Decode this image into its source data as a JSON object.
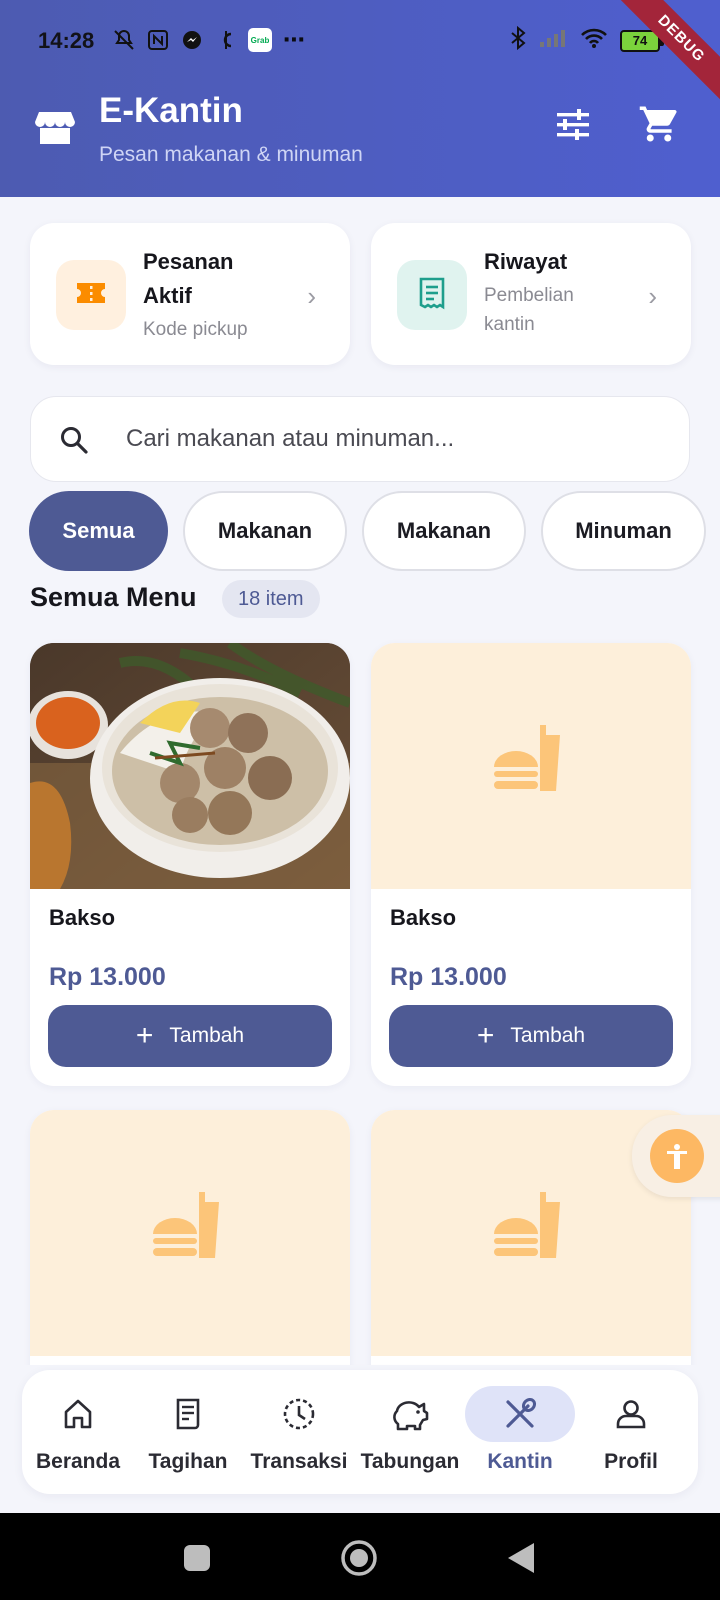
{
  "status": {
    "time": "14:28",
    "battery": "74",
    "debug_label": "DEBUG",
    "grab_label": "Grab"
  },
  "header": {
    "title": "E-Kantin",
    "subtitle": "Pesan makanan & minuman",
    "icons": [
      "store-icon",
      "filter-icon",
      "cart-icon"
    ]
  },
  "quick_cards": [
    {
      "title_line1": "Pesanan",
      "title_line2": "Aktif",
      "subtitle": "Kode pickup",
      "icon": "ticket-icon",
      "color": "#fb8c00",
      "bg": "#fff0df"
    },
    {
      "title_line1": "Riwayat",
      "subtitle_line1": "Pembelian",
      "subtitle_line2": "kantin",
      "icon": "receipt-icon",
      "color": "#1e9e8c",
      "bg": "#e0f3ef"
    }
  ],
  "search": {
    "placeholder": "Cari makanan atau minuman..."
  },
  "chips": [
    "Semua",
    "Makanan",
    "Makanan",
    "Minuman"
  ],
  "section": {
    "title": "Semua Menu",
    "badge": "18 item"
  },
  "products": [
    {
      "name": "Bakso",
      "price": "Rp 13.000",
      "button": "Tambah",
      "has_photo": true
    },
    {
      "name": "Bakso",
      "price": "Rp 13.000",
      "button": "Tambah",
      "has_photo": false
    },
    {
      "has_photo": false
    },
    {
      "has_photo": false
    }
  ],
  "bottom_nav": [
    {
      "label": "Beranda",
      "icon": "home-icon"
    },
    {
      "label": "Tagihan",
      "icon": "bill-icon"
    },
    {
      "label": "Transaksi",
      "icon": "history-icon"
    },
    {
      "label": "Tabungan",
      "icon": "piggy-bank-icon"
    },
    {
      "label": "Kantin",
      "icon": "utensils-icon",
      "active": true
    },
    {
      "label": "Profil",
      "icon": "person-icon"
    }
  ],
  "colors": {
    "primary": "#4e5a94",
    "header_start": "#4d5bb1",
    "header_end": "#4f5fcf",
    "accent_orange": "#fdb863"
  }
}
